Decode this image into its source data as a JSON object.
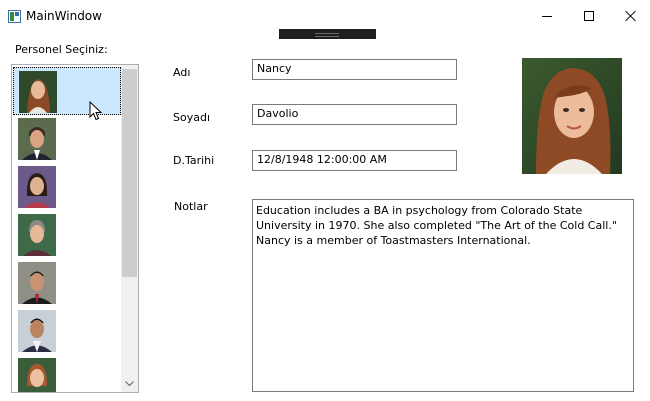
{
  "window": {
    "title": "MainWindow"
  },
  "personnel": {
    "label": "Personel Seçiniz:",
    "items": [
      {
        "icon": "female-portrait-icon",
        "selected": true
      },
      {
        "icon": "male-portrait-icon",
        "selected": false
      },
      {
        "icon": "female-portrait-icon",
        "selected": false
      },
      {
        "icon": "female-portrait-icon",
        "selected": false
      },
      {
        "icon": "male-portrait-icon",
        "selected": false
      },
      {
        "icon": "male-portrait-icon",
        "selected": false
      },
      {
        "icon": "female-portrait-icon",
        "selected": false
      }
    ]
  },
  "form": {
    "first_name_label": "Adı",
    "first_name_value": "Nancy",
    "last_name_label": "Soyadı",
    "last_name_value": "Davolio",
    "birth_date_label": "D.Tarihi",
    "birth_date_value": "12/8/1948 12:00:00 AM",
    "notes_label": "Notlar",
    "notes_value": "Education includes a BA in psychology from Colorado State University in 1970.  She also completed \"The Art of the Cold Call.\"  Nancy is a member of Toastmasters International."
  },
  "colors": {
    "selection": "#cce8ff",
    "border": "#7a7a7a",
    "scroll_thumb": "#cdcdcd"
  }
}
